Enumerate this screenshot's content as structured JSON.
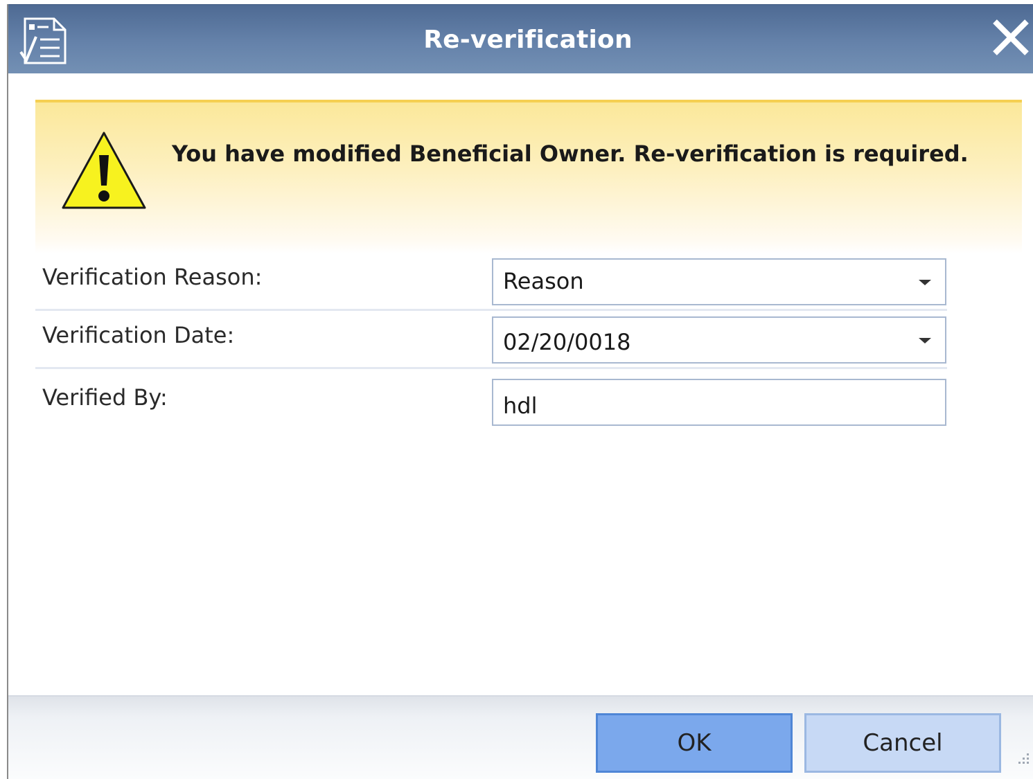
{
  "dialog": {
    "title": "Re-verification",
    "title_icon": "checklist-document-icon",
    "close_icon": "close-icon"
  },
  "warning": {
    "icon": "warning-triangle-icon",
    "message": "You have modified Beneficial Owner. Re-verification is required.",
    "background_color": "#fbe89a"
  },
  "form": {
    "reason": {
      "label": "Verification Reason:",
      "value": "Reason"
    },
    "date": {
      "label": "Verification Date:",
      "value": "02/20/0018"
    },
    "verified_by": {
      "label": "Verified By:",
      "value": "hdl"
    }
  },
  "buttons": {
    "ok_label": "OK",
    "cancel_label": "Cancel"
  },
  "colors": {
    "titlebar": "#5a779f",
    "ok_button": "#7ba8ec",
    "cancel_button": "#c7d9f5"
  }
}
